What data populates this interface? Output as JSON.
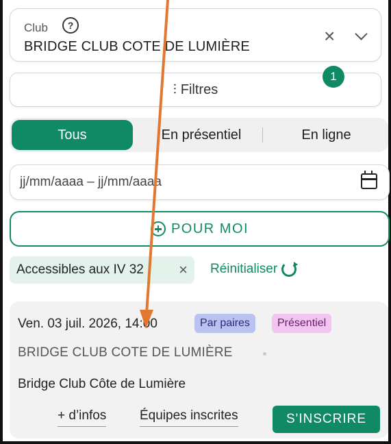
{
  "club": {
    "label": "Club",
    "value": "BRIDGE CLUB COTE DE LUMIÈRE",
    "help_icon": "help-icon",
    "clear_icon": "close-icon",
    "chevron_icon": "chevron-down-icon"
  },
  "filters": {
    "label": "Filtres",
    "badge": "1",
    "icon": "sliders-icon"
  },
  "segment": {
    "items": [
      "Tous",
      "En présentiel",
      "En ligne"
    ],
    "active": "Tous"
  },
  "date_field": {
    "placeholder": "jj/mm/aaaa – jj/mm/aaaa",
    "icon": "calendar-icon"
  },
  "pour_moi": {
    "label": "POUR MOI",
    "icon": "add-circle-icon"
  },
  "chip": {
    "label": "Accessibles aux IV 32",
    "close": "×"
  },
  "reset": {
    "label": "Réinitialiser",
    "icon": "refresh-icon"
  },
  "event": {
    "date": "Ven. 03 juil. 2026, 14:00",
    "tags": [
      "Par paires",
      "Présentiel"
    ],
    "club": "BRIDGE CLUB COTE DE LUMIÈRE",
    "description": "Bridge Club Côte de Lumière",
    "links": [
      "+ d’infos",
      "Équipes inscrites"
    ],
    "cta": "S'INSCRIRE"
  },
  "colors": {
    "accent": "#0f8a65",
    "annotation_arrow": "#e0792f"
  }
}
